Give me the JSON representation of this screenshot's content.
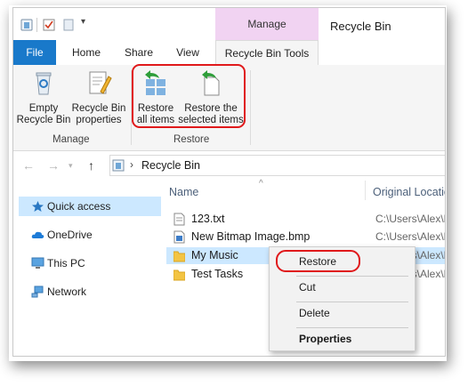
{
  "window": {
    "title": "Recycle Bin",
    "context_tab": "Manage",
    "tabs": [
      "File",
      "Home",
      "Share",
      "View",
      "Recycle Bin Tools"
    ],
    "active_tab": "Recycle Bin Tools"
  },
  "ribbon": {
    "buttons": [
      {
        "line1": "Empty",
        "line2": "Recycle Bin",
        "icon": "recycle-bin-icon"
      },
      {
        "line1": "Recycle Bin",
        "line2": "properties",
        "icon": "properties-icon"
      },
      {
        "line1": "Restore",
        "line2": "all items",
        "icon": "restore-all-icon"
      },
      {
        "line1": "Restore the",
        "line2": "selected items",
        "icon": "restore-selected-icon"
      }
    ],
    "groups": [
      "Manage",
      "Restore"
    ]
  },
  "address": {
    "path": "Recycle Bin",
    "icons": [
      "back-arrow-icon",
      "forward-arrow-icon",
      "dropdown-icon",
      "up-arrow-icon",
      "recycle-bin-icon",
      "chevron-right-icon"
    ]
  },
  "nav": {
    "items": [
      {
        "label": "Quick access",
        "icon": "star-icon",
        "selected": true
      },
      {
        "label": "OneDrive",
        "icon": "cloud-icon",
        "selected": false
      },
      {
        "label": "This PC",
        "icon": "computer-icon",
        "selected": false
      },
      {
        "label": "Network",
        "icon": "network-icon",
        "selected": false
      }
    ]
  },
  "files": {
    "columns": [
      "Name",
      "Original Locatio"
    ],
    "rows": [
      {
        "name": "123.txt",
        "location": "C:\\Users\\Alex\\D",
        "icon": "text-file-icon",
        "selected": false
      },
      {
        "name": "New Bitmap Image.bmp",
        "location": "C:\\Users\\Alex\\D",
        "icon": "image-file-icon",
        "selected": false
      },
      {
        "name": "My Music",
        "location": "C:\\Users\\Alex\\D",
        "icon": "folder-icon",
        "selected": true
      },
      {
        "name": "Test Tasks",
        "location": "C:\\Users\\Alex\\D",
        "icon": "folder-icon",
        "selected": false
      }
    ]
  },
  "context_menu": {
    "items": [
      "Restore",
      "Cut",
      "Delete",
      "Properties"
    ]
  },
  "colors": {
    "file_tab": "#1979ca",
    "manage_tab": "#f1d3f2",
    "selection": "#cce8ff",
    "highlight": "#e0191b"
  }
}
